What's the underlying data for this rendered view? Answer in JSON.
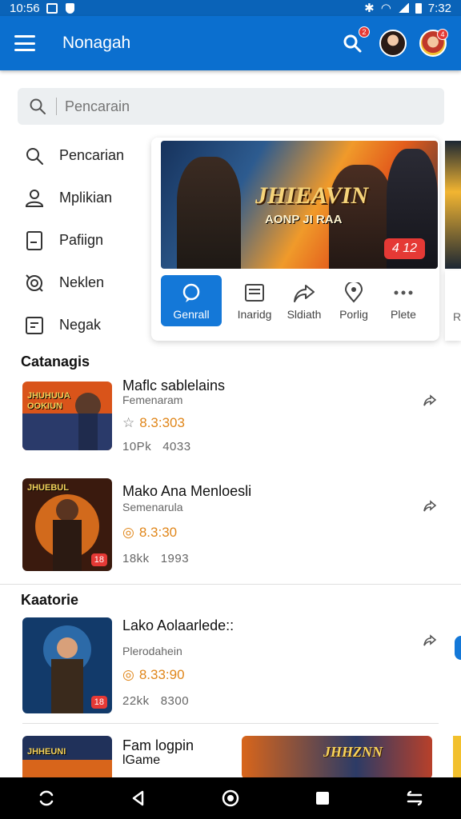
{
  "status_bar": {
    "time": "10:56",
    "clock_right": "7:32"
  },
  "app_bar": {
    "title": "Nonagah",
    "notification_badge": "2",
    "profile_badge": "4"
  },
  "search": {
    "placeholder": "Pencarain"
  },
  "side_menu": {
    "items": [
      {
        "label": "Pencarian",
        "icon": "search-icon"
      },
      {
        "label": "Mplikian",
        "icon": "users-icon"
      },
      {
        "label": "Pafiign",
        "icon": "document-icon"
      },
      {
        "label": "Neklen",
        "icon": "settings-icon"
      },
      {
        "label": "Negak",
        "icon": "list-icon"
      }
    ]
  },
  "featured": {
    "banner_title": "JHIEAVIN",
    "banner_subtitle": "AONP JI RAA",
    "banner_chip": "4 12",
    "actions": [
      {
        "label": "Genrall",
        "icon": "chat-icon"
      },
      {
        "label": "Inaridg",
        "icon": "notes-icon"
      },
      {
        "label": "Sldiath",
        "icon": "share-icon"
      },
      {
        "label": "Porlig",
        "icon": "location-icon"
      },
      {
        "label": "Plete",
        "icon": "more-icon"
      }
    ],
    "next_card_label": "R"
  },
  "sections": {
    "section1_title": "Catanagis",
    "section2_title": "Kaatorie"
  },
  "games": [
    {
      "title": "Maflc sablelains",
      "subtitle": "Femenaram",
      "rating": "8.3:303",
      "downloads": "10Pk",
      "count": "4033",
      "thumb_text": "JHUHUUA OOKIUN",
      "tag": ""
    },
    {
      "title": "Mako Ana Menloesli",
      "subtitle": "Semenarula",
      "rating": "8.3:30",
      "downloads": "18kk",
      "count": "1993",
      "thumb_text": "JHUEBUL",
      "tag": "18"
    },
    {
      "title": "Lako Aolaarlede::",
      "subtitle": "Plerodahein",
      "rating": "8.33:90",
      "downloads": "22kk",
      "count": "8300",
      "thumb_text": "",
      "tag": "18"
    },
    {
      "title": "Fam logpin",
      "subtitle": "lGame",
      "thumb_text": "JHHEUNI"
    }
  ],
  "bottom_promo": {
    "text": "JHHZNN"
  },
  "colors": {
    "app_bar": "#0b6fcf",
    "status_bar": "#0a63b8",
    "accent": "#1478d8",
    "rating": "#e0861a",
    "badge": "#e53935"
  }
}
